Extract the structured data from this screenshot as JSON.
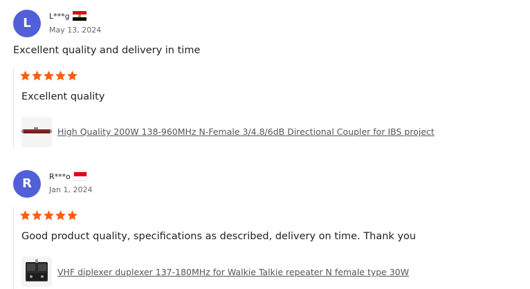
{
  "reviews": [
    {
      "avatar_letter": "L",
      "user_name": "L***g",
      "country_flag": "egypt-flag-icon",
      "date": "May 13, 2024",
      "text": "Excellent quality and delivery in time",
      "stars": 5,
      "additional_text": "Excellent quality",
      "product_title": "High Quality 200W 138-960MHz N-Female 3/4.8/6dB Directional Coupler for IBS project",
      "product_icon": "directional-coupler-product-image"
    },
    {
      "avatar_letter": "R",
      "user_name": "R***o",
      "country_flag": "indonesia-flag-icon",
      "date": "Jan 1, 2024",
      "text": "",
      "stars": 5,
      "additional_text": "Good product quality, specifications as described, delivery on time. Thank you",
      "product_title": "VHF diplexer duplexer 137-180MHz for Walkie Talkie repeater N female type 30W",
      "product_icon": "duplexer-product-image"
    }
  ],
  "colors": {
    "avatar_bg": "#5160d8",
    "star": "#fd5e0f",
    "link": "#555555"
  }
}
